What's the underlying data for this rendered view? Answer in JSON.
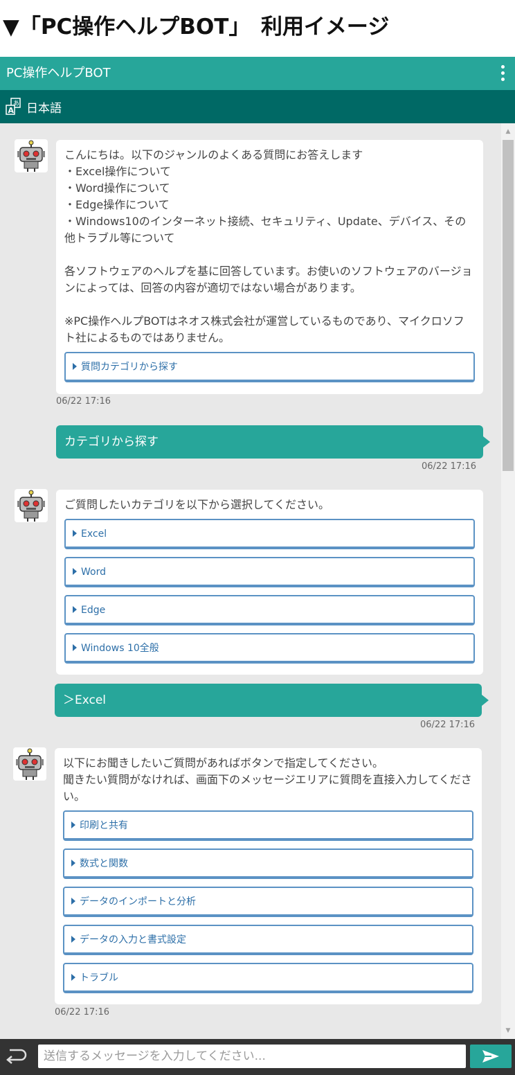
{
  "page_heading": "▼「PC操作ヘルプBOT」　利用イメージ",
  "header": {
    "title": "PC操作ヘルプBOT",
    "menu_icon": "kebab-menu-icon"
  },
  "language": {
    "label": "日本語",
    "icon": "translate-icon"
  },
  "messages": {
    "bot1": {
      "text": "こんにちは。以下のジャンルのよくある質問にお答えします\n・Excel操作について\n・Word操作について\n・Edge操作について\n・Windows10のインターネット接続、セキュリティ、Update、デバイス、その他トラブル等について\n\n各ソフトウェアのヘルプを基に回答しています。お使いのソフトウェアのバージョンによっては、回答の内容が適切ではない場合があります。\n\n※PC操作ヘルプBOTはネオス株式会社が運営しているものであり、マイクロソフト社によるものではありません。",
      "options": [
        "質問カテゴリから探す"
      ],
      "time": "06/22 17:16"
    },
    "user1": {
      "text": "カテゴリから探す",
      "time": "06/22 17:16"
    },
    "bot2": {
      "text": "ご質問したいカテゴリを以下から選択してください。",
      "options": [
        "Excel",
        "Word",
        "Edge",
        "Windows 10全般"
      ]
    },
    "user2": {
      "text": "＞Excel",
      "time": "06/22 17:16"
    },
    "bot3": {
      "text": "以下にお聞きしたいご質問があればボタンで指定してください。\n聞きたい質問がなければ、画面下のメッセージエリアに質問を直接入力してください。",
      "options": [
        "印刷と共有",
        "数式と関数",
        "データのインポートと分析",
        "データの入力と書式設定",
        "トラブル"
      ],
      "time": "06/22 17:16"
    }
  },
  "composer": {
    "placeholder": "送信するメッセージを入力してください...",
    "back_icon": "back-arrow-icon",
    "send_icon": "send-icon"
  },
  "colors": {
    "accent": "#27a69a",
    "accent_dark": "#006965",
    "option_border": "#5b92c4",
    "chat_bg": "#e8e8e8"
  }
}
